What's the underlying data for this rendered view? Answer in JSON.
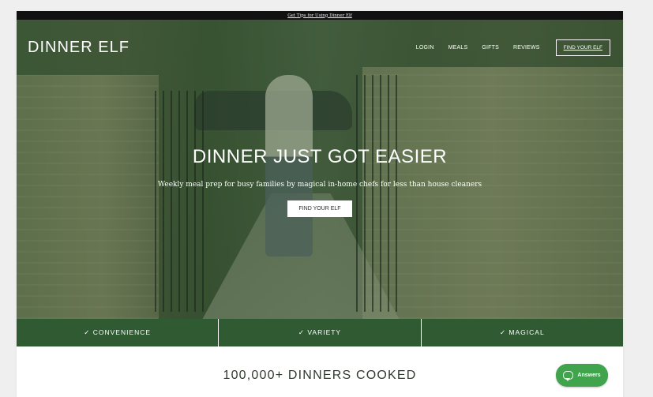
{
  "topbar": {
    "link_text": "Get Tips for Using Dinner Elf"
  },
  "header": {
    "logo": "DINNER ELF",
    "nav": [
      {
        "label": "LOGIN"
      },
      {
        "label": "MEALS"
      },
      {
        "label": "GIFTS"
      },
      {
        "label": "REVIEWS"
      }
    ],
    "cta_label": "FIND YOUR ELF"
  },
  "hero": {
    "headline": "DINNER JUST GOT EASIER",
    "subheadline": "Weekly meal prep for busy families by magical in-home chefs for less than house cleaners",
    "cta_label": "FIND YOUR ELF"
  },
  "features": [
    {
      "label": "✓ CONVENIENCE"
    },
    {
      "label": "✓ VARIETY"
    },
    {
      "label": "✓ MAGICAL"
    }
  ],
  "stats": {
    "dinners_cooked": "100,000+ DINNERS COOKED"
  },
  "chat_widget": {
    "label": "Answers",
    "icon": "chat-icon"
  },
  "colors": {
    "brand_green": "#2f5a32",
    "chat_green": "#3fa44b",
    "topbar": "#111111"
  }
}
